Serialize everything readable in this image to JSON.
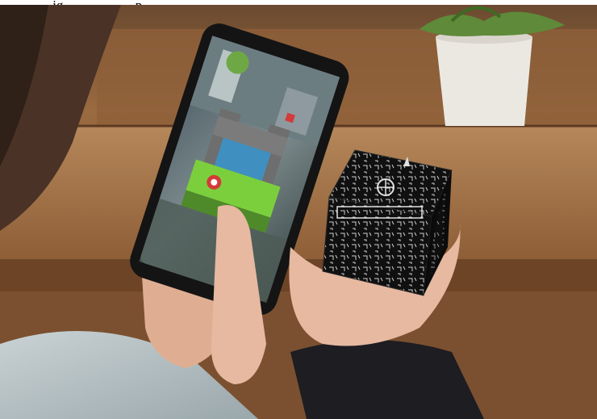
{
  "caption": "… ig … … … … p … … …",
  "photo": {
    "description_alt": "Person holding a smartphone showing an augmented reality castle scene over a black patterned cube held in the other hand",
    "colors": {
      "wood": "#8a5a33",
      "wood_dark": "#5a3820",
      "wall": "#a3744a",
      "phone": "#141414",
      "cube": "#111111",
      "skin": "#e6b9a0",
      "sleeve": "#b7c2c5",
      "hair": "#4a3326",
      "pot": "#ebe8e2",
      "plant": "#5e8a3a"
    }
  }
}
